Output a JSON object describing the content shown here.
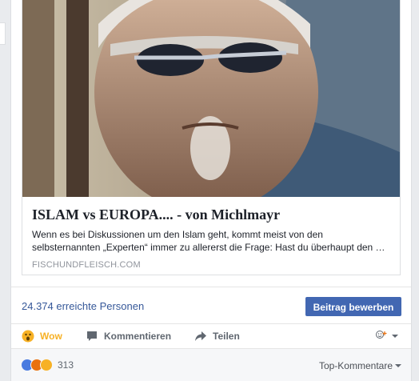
{
  "link": {
    "title": "ISLAM vs EUROPA.... - von Michlmayr",
    "description": "Wenn es bei Diskussionen um den Islam geht, kommt meist von den selbsternannten „Experten“ immer zu allererst die Frage: Hast du überhaupt den …",
    "domain": "FISCHUNDFLEISCH.COM"
  },
  "reach": {
    "text": "24.374 erreichte Personen",
    "boost_label": "Beitrag bewerben"
  },
  "actions": {
    "wow": "Wow",
    "comment": "Kommentieren",
    "share": "Teilen"
  },
  "footer": {
    "reaction_count": "313",
    "sort_label": "Top-Kommentare"
  },
  "colors": {
    "link": "#365899",
    "button": "#4267b2",
    "wow": "#f7b125"
  }
}
